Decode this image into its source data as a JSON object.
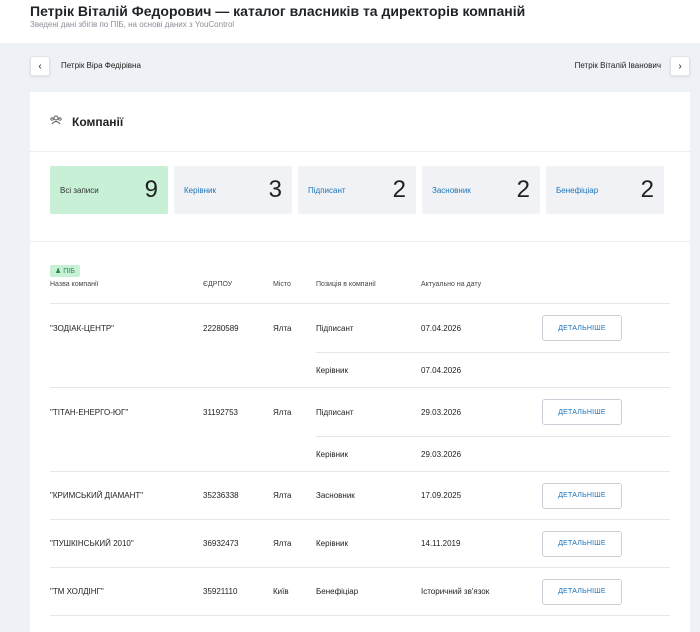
{
  "header": {
    "title": "Петрік Віталій Федорович — каталог власників та директорів компаній",
    "subtitle": "Зведені дані збігів по ПІБ, на основі даних з YouControl"
  },
  "nav": {
    "prev_label": "Петрік Віра Федірівна",
    "next_label": "Петрік Віталій Іванович",
    "prev_icon": "‹",
    "next_icon": "›"
  },
  "section": {
    "title": "Компанії",
    "icon": "people-icon"
  },
  "stats": [
    {
      "label": "Всі записи",
      "count": "9"
    },
    {
      "label": "Керівник",
      "count": "3"
    },
    {
      "label": "Підписант",
      "count": "2"
    },
    {
      "label": "Засновник",
      "count": "2"
    },
    {
      "label": "Бенефіціар",
      "count": "2"
    }
  ],
  "tag": "ПІБ",
  "table": {
    "headers": [
      "Назва компанії",
      "ЄДРПОУ",
      "Місто",
      "Позиція в компанії",
      "Актуально на дату"
    ],
    "button_label": "ДЕТАЛЬНІШЕ",
    "rows": [
      {
        "name": "\"ЗОДІАК-ЦЕНТР\"",
        "code": "22280589",
        "city": "Ялта",
        "position": "Підписант",
        "date": "07.04.2026",
        "sub_position": "Керівник",
        "sub_date": "07.04.2026"
      },
      {
        "name": "\"ТІТАН-ЕНЕРГО-ЮГ\"",
        "code": "31192753",
        "city": "Ялта",
        "position": "Підписант",
        "date": "29.03.2026",
        "sub_position": "Керівник",
        "sub_date": "29.03.2026"
      },
      {
        "name": "\"КРИМСЬКИЙ ДІАМАНТ\"",
        "code": "35236338",
        "city": "Ялта",
        "position": "Засновник",
        "date": "17.09.2025"
      },
      {
        "name": "\"ПУШКІНСЬКИЙ 2010\"",
        "code": "36932473",
        "city": "Ялта",
        "position": "Керівник",
        "date": "14.11.2019"
      },
      {
        "name": "\"ТМ ХОЛДІНГ\"",
        "code": "35921110",
        "city": "Київ",
        "position": "Бенефіціар",
        "date": "Історичний зв'язок"
      }
    ]
  }
}
